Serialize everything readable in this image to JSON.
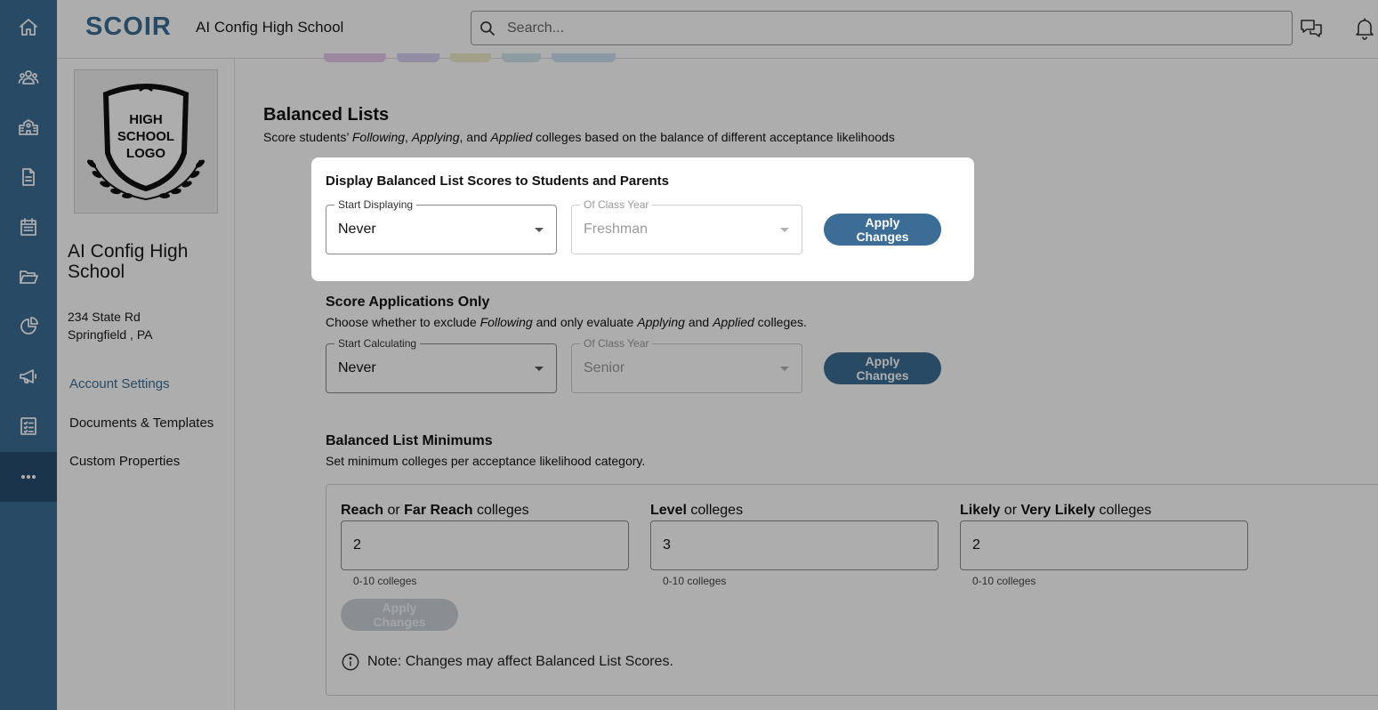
{
  "app": {
    "logo": "SCOIR",
    "school_name": "AI Config High School",
    "search_placeholder": "Search..."
  },
  "rail": {
    "icons": [
      "home-icon",
      "students-icon",
      "school-icon",
      "document-icon",
      "calendar-icon",
      "folder-icon",
      "analytics-icon",
      "megaphone-icon",
      "checklist-icon",
      "more-icon"
    ],
    "active": "more-icon"
  },
  "sidebar": {
    "logo_lines": [
      "HIGH",
      "SCHOOL",
      "LOGO"
    ],
    "school_name": "AI Config High School",
    "address_line1": "234 State Rd",
    "address_line2": "Springfield , PA",
    "nav": [
      {
        "label": "Account Settings",
        "active": true
      },
      {
        "label": "Documents & Templates",
        "active": false
      },
      {
        "label": "Custom Properties",
        "active": false
      }
    ]
  },
  "balanced_lists": {
    "title": "Balanced Lists",
    "subtitle_parts": [
      "Score students’ ",
      "Following",
      ", ",
      "Applying",
      ", and ",
      "Applied",
      " colleges based on the balance of different acceptance likelihoods"
    ]
  },
  "display_scores": {
    "title": "Display Balanced List Scores to Students and Parents",
    "start_label": "Start Displaying",
    "start_value": "Never",
    "class_label": "Of Class Year",
    "class_value": "Freshman",
    "apply_label": "Apply Changes"
  },
  "score_apps": {
    "title": "Score Applications Only",
    "desc_parts": [
      "Choose whether to exclude ",
      "Following",
      " and only evaluate ",
      "Applying",
      " and ",
      "Applied",
      " colleges."
    ],
    "start_label": "Start Calculating",
    "start_value": "Never",
    "class_label": "Of Class Year",
    "class_value": "Senior",
    "apply_label": "Apply Changes"
  },
  "minimums": {
    "title": "Balanced List Minimums",
    "desc": "Set minimum colleges per acceptance likelihood category.",
    "fields": [
      {
        "label_parts": [
          "Reach",
          " or ",
          "Far Reach",
          " colleges"
        ],
        "value": "2",
        "help": "0-10 colleges"
      },
      {
        "label_parts": [
          "Level",
          " colleges"
        ],
        "value": "3",
        "help": "0-10 colleges"
      },
      {
        "label_parts": [
          "Likely",
          " or ",
          "Very Likely",
          " colleges"
        ],
        "value": "2",
        "help": "0-10 colleges"
      }
    ],
    "apply_label": "Apply Changes",
    "note": "Note: Changes may affect Balanced List Scores."
  },
  "colors": {
    "brand": "#3b6d96",
    "brand_dark": "#274e6f",
    "overlay": "rgba(0,0,0,0.32)"
  }
}
